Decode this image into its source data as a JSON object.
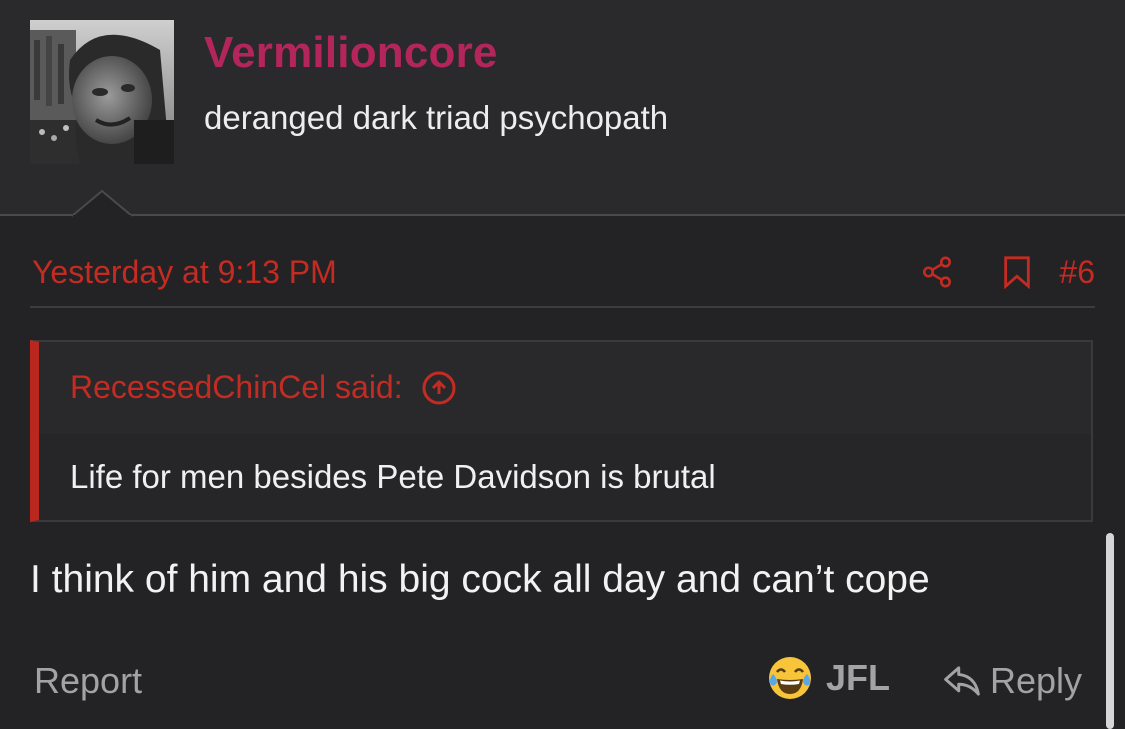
{
  "user": {
    "name": "Vermilioncore",
    "title": "deranged dark triad psychopath",
    "name_color": "#b4255c"
  },
  "message": {
    "date": "Yesterday at 9:13 PM",
    "number": "#6",
    "quote": {
      "author": "RecessedChinCel said:",
      "text": "Life for men besides Pete Davidson is brutal"
    },
    "body": "I think of him and his big cock all day and can’t cope"
  },
  "footer": {
    "report_label": "Report",
    "reaction_label": "JFL",
    "reply_label": "Reply"
  },
  "icons": {
    "share": "share-icon",
    "bookmark": "bookmark-icon",
    "quote_jump": "arrow-up-circle-icon",
    "reaction": "laughing-crying-emoji-icon",
    "reply": "reply-arrow-icon"
  },
  "colors": {
    "accent_red": "#c42b22",
    "username": "#b4255c",
    "background": "#232325",
    "muted_text": "#a3a3a5"
  }
}
